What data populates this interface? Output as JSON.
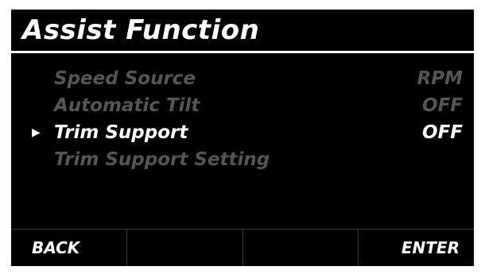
{
  "screen": {
    "title": "Assist Function"
  },
  "menu": {
    "items": [
      {
        "label": "Speed Source",
        "value": "RPM",
        "selected": false,
        "enabled": false
      },
      {
        "label": "Automatic Tilt",
        "value": "OFF",
        "selected": false,
        "enabled": false
      },
      {
        "label": "Trim Support",
        "value": "OFF",
        "selected": true,
        "enabled": true
      },
      {
        "label": "Trim Support Setting",
        "value": "",
        "selected": false,
        "enabled": false
      }
    ],
    "pointer_icon": "right-triangle-icon"
  },
  "softkeys": {
    "k1": "BACK",
    "k2": "",
    "k3": "",
    "k4": "ENTER"
  },
  "colors": {
    "background": "#000000",
    "frame": "#ffffff",
    "text_active": "#ffffff",
    "text_disabled": "#555555",
    "divider": "#3a3a3a"
  }
}
